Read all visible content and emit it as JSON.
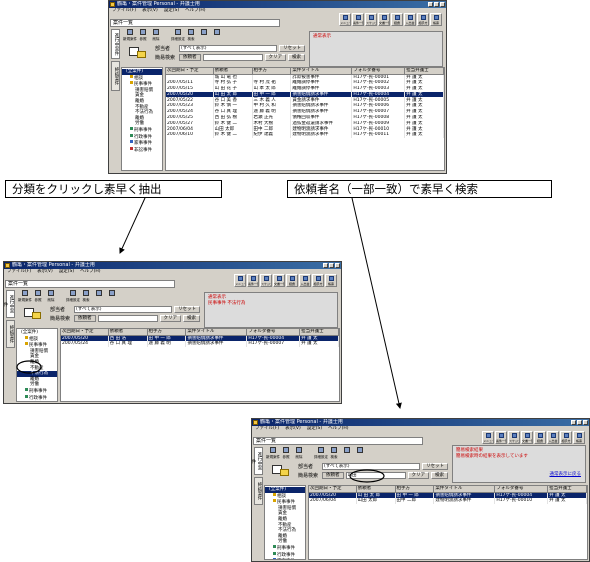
{
  "captions": {
    "classify": "分類をクリックし素早く抽出",
    "search": "依頼者名（一部一致）で素早く検索"
  },
  "app": {
    "title": "鶴亀・案件管理 Personal - 弁護士用",
    "menu": [
      "ファイル(F)",
      "表示(V)",
      "設定(S)",
      "ヘルプ(H)"
    ],
    "tab_label": "案件一覧",
    "vtabs": [
      "進行中案件",
      "終結案件"
    ],
    "left_buttons": [
      "新規案件",
      "参照",
      "削除",
      "",
      "詳細設定"
    ],
    "toolbar_buttons": [
      "メニュー",
      "案件一覧",
      "スケジュール",
      "文書一覧",
      "経費",
      "入出金",
      "相手方",
      "帳票"
    ],
    "form": {
      "bunrui_label": "部当者",
      "bunrui_value": "(すべて表示)",
      "reset": "リセット",
      "search_label": "簡易検索",
      "client_label": "依頼者",
      "clear": "クリア",
      "search": "検索"
    },
    "tree": [
      "(全案件)",
      "相談",
      "民事事件",
      "損害賠償",
      "賃金",
      "離婚",
      "不動産",
      "不法行為",
      "離婚",
      "労働",
      "刑事事件",
      "行政事件",
      "家事事件",
      "非訟事件"
    ],
    "columns": [
      "次回期日・予定",
      "依頼者",
      "相手方",
      "案件タイトル",
      "フォルダ番号",
      "担当弁護士"
    ],
    "rows": [
      [
        "",
        "城 山 竜 也",
        "",
        "詐欺被害事件",
        "H17ケ-民-00001",
        "弁 護 太"
      ],
      [
        "2007/05/11",
        "寺 村 弘 子",
        "寺 村 茂 祐",
        "離婚調停事件",
        "H17ケ-民-00002",
        "弁 護 太"
      ],
      [
        "2007/05/15",
        "山 田 花 子",
        "山 本 太 郎",
        "離婚調停事件",
        "H17ケ-民-00003",
        "弁 護 太"
      ],
      [
        "2007/05/20",
        "山 田 太 郎",
        "田 中 一 郎",
        "損害賠償請求事件",
        "H17ケ-民-00004",
        "弁 護 太"
      ],
      [
        "2007/05/22",
        "谷 口 美 香",
        "三 木 義 人",
        "賃金請求事件",
        "H17ケ-民-00005",
        "弁 護 太"
      ],
      [
        "2007/05/23",
        "鈴 木 慎 一",
        "中 村 久 和",
        "損害賠償請求事件",
        "H17ケ-民-00006",
        "弁 護 太"
      ],
      [
        "2007/05/24",
        "谷 口 真 理",
        "遠 藤 義 明",
        "損害賠償請求事件",
        "H17ケ-民-00007",
        "弁 護 太"
      ],
      [
        "2007/05/25",
        "西 田 弘 樹",
        "岩瀬 正光",
        "債権回収事件",
        "H17ケ-民-00008",
        "弁 護 太"
      ],
      [
        "2007/05/27",
        "鈴 木 健 二",
        "木村 大樹",
        "過払金返還請求事件",
        "H17ケ-民-00009",
        "弁 護 太"
      ],
      [
        "2007/06/04",
        "山田 太郎",
        "田中 二郎",
        "建物明渡請求事件",
        "H17ケ-民-00010",
        "弁 護 太"
      ],
      [
        "2007/06/10",
        "鈴 木 健 二",
        "紀伊 達義",
        "建物明渡請求事件",
        "H17ケ-民-00011",
        "弁 護 太"
      ]
    ],
    "selected_row": 3
  },
  "win1": {
    "notice_title": "通常表示",
    "notice_body": ""
  },
  "win2": {
    "notice_title": "通常表示",
    "notice_body": "民事事件 不法行為",
    "tree_selected": 7,
    "rows": [
      [
        "2007/05/20",
        "西 田 浩",
        "田 中 一 郎",
        "損害賠償請求事件",
        "H17ケ-民-00004",
        "弁 護 太"
      ],
      [
        "2007/05/24",
        "谷 口 真 理",
        "遠 藤 義 明",
        "損害賠償請求事件",
        "H17ケ-民-00007",
        "弁 護 太"
      ]
    ]
  },
  "win3": {
    "notice_title": "簡易検索結果",
    "notice_body": "簡易検索時の結果を表示しています",
    "notice_link": "通常表示に戻る",
    "client_value": "山田",
    "rows": [
      [
        "2007/05/20",
        "山 田 太 郎",
        "田 中 一 郎",
        "損害賠償請求事件",
        "H17ケ-民-00004",
        "弁 護 太"
      ],
      [
        "2007/06/04",
        "山田 太郎",
        "田中 二郎",
        "建物明渡請求事件",
        "H17ケ-民-00010",
        "弁 護 太"
      ]
    ]
  },
  "colors": {
    "selection": "#0a246a",
    "title_bar": "#0a246a",
    "notice_text": "#cc0000"
  }
}
